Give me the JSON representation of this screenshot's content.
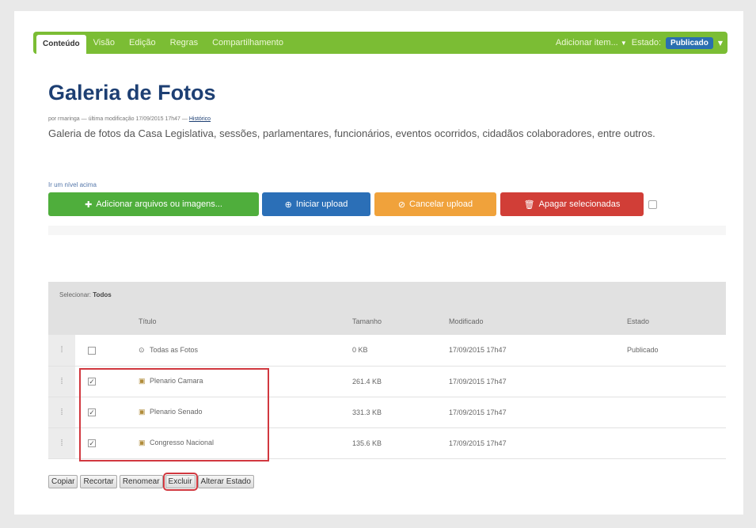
{
  "toolbar": {
    "tabs": [
      "Conteúdo",
      "Visão",
      "Edição",
      "Regras",
      "Compartilhamento"
    ],
    "add_item": "Adicionar item...",
    "state_label": "Estado:",
    "state_value": "Publicado"
  },
  "page": {
    "title": "Galeria de Fotos",
    "byline": "por rmaringa — última modificação 17/09/2015 17h47 —",
    "byline_link": "Histórico",
    "description": "Galeria de fotos da Casa Legislativa, sessões, parlamentares, funcionários, eventos ocorridos, cidadãos colaboradores, entre outros.",
    "goto_link": "Ir um nível acima"
  },
  "upload": {
    "add": "Adicionar arquivos ou imagens...",
    "start": "Iniciar upload",
    "cancel": "Cancelar upload",
    "delete": "Apagar selecionadas"
  },
  "listing": {
    "select_label": "Selecionar:",
    "select_all": "Todos",
    "columns": [
      "Título",
      "Tamanho",
      "Modificado",
      "Estado"
    ],
    "rows": [
      {
        "title": "Todas as Fotos",
        "size": "0 KB",
        "modified": "17/09/2015 17h47",
        "state": "Publicado",
        "checked": ""
      },
      {
        "title": "Plenario Camara",
        "size": "261.4 KB",
        "modified": "17/09/2015 17h47",
        "state": "",
        "checked": "✓"
      },
      {
        "title": "Plenario Senado",
        "size": "331.3 KB",
        "modified": "17/09/2015 17h47",
        "state": "",
        "checked": "✓"
      },
      {
        "title": "Congresso Nacional",
        "size": "135.6 KB",
        "modified": "17/09/2015 17h47",
        "state": "",
        "checked": "✓"
      }
    ]
  },
  "actions": [
    "Copiar",
    "Recortar",
    "Renomear",
    "Excluir",
    "Alterar Estado"
  ],
  "colors": {
    "toolbar_green": "#7bbd34",
    "title_blue": "#1d3f73",
    "highlight_red": "#d1383f"
  }
}
